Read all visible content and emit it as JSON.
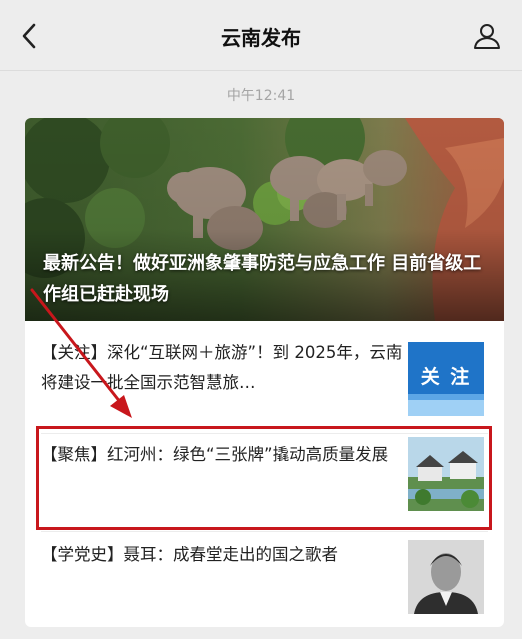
{
  "header": {
    "title": "云南发布",
    "back_icon": "back-chevron-icon",
    "user_icon": "user-profile-icon"
  },
  "message_time": "中午12:41",
  "hero": {
    "title": "最新公告！做好亚洲象肇事防范与应急工作 目前省级工作组已赶赴现场"
  },
  "articles": [
    {
      "text": "【关注】深化“互联网＋旅游”！到 2025年，云南将建设一批全国示范智慧旅…",
      "thumb_label": "关 注"
    },
    {
      "text": "【聚焦】红河州：绿色“三张牌”撬动高质量发展"
    },
    {
      "text": "【学党史】聂耳：成春堂走出的国之歌者"
    }
  ],
  "colors": {
    "highlight": "#c8171c",
    "thumb_blue": "#1f74c8"
  }
}
